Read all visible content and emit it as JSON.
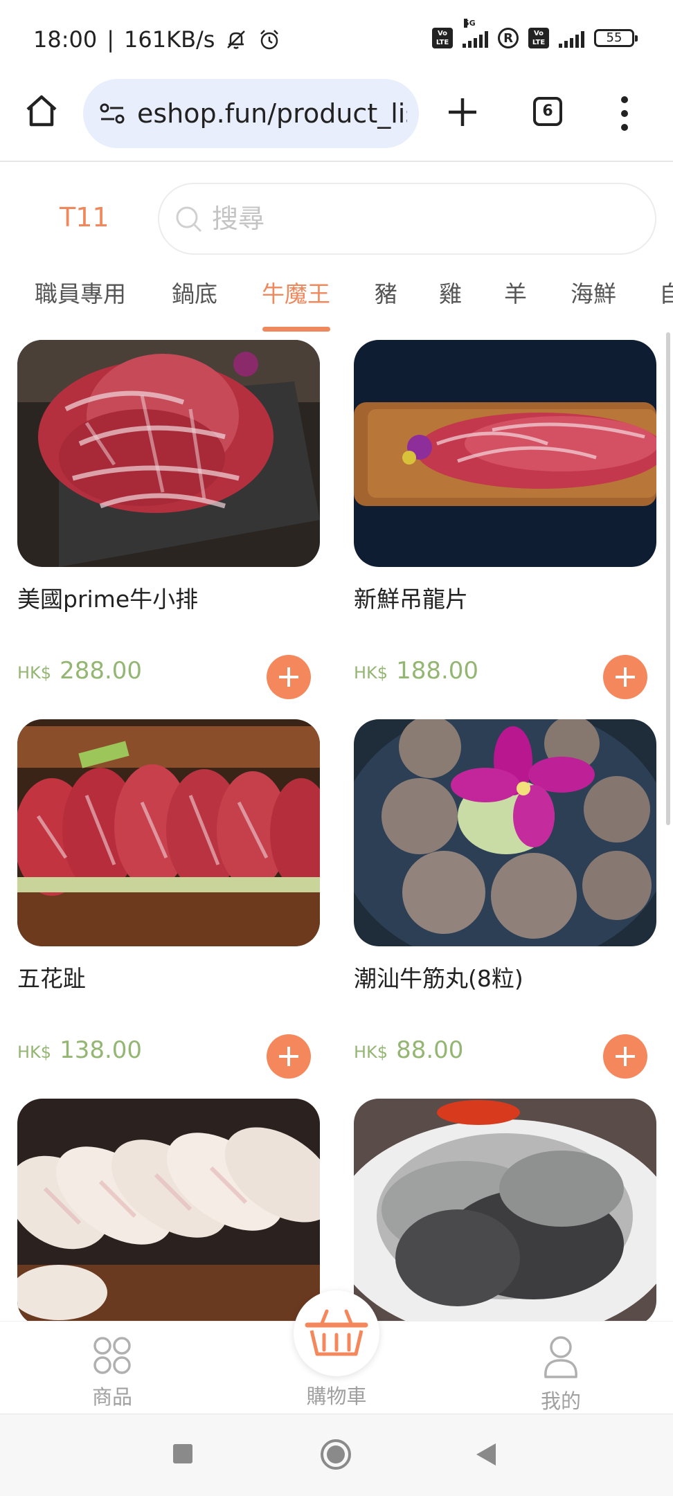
{
  "status_bar": {
    "time": "18:00",
    "net_speed": "161KB/s",
    "network_label": "5G",
    "battery": "55",
    "volte_label": "Vo LTE",
    "roaming_label": "R"
  },
  "browser": {
    "url": "eshop.fun/product_lis",
    "tab_count": "6"
  },
  "header": {
    "table_label": "T11",
    "search_placeholder": "搜尋"
  },
  "categories": {
    "active_index": 2,
    "items": [
      "職員專用",
      "鍋底",
      "牛魔王",
      "豬",
      "雞",
      "羊",
      "海鮮",
      "自"
    ]
  },
  "products": [
    {
      "name": "美國prime牛小排",
      "currency": "HK$",
      "price": "288.00"
    },
    {
      "name": "新鮮吊龍片",
      "currency": "HK$",
      "price": "188.00"
    },
    {
      "name": "五花趾",
      "currency": "HK$",
      "price": "138.00"
    },
    {
      "name": "潮汕牛筋丸(8粒)",
      "currency": "HK$",
      "price": "88.00"
    },
    {
      "name": "",
      "currency": "",
      "price": ""
    },
    {
      "name": "",
      "currency": "",
      "price": ""
    }
  ],
  "bottom_nav": {
    "products_label": "商品",
    "cart_label": "購物車",
    "mine_label": "我的"
  },
  "colors": {
    "accent": "#f4885c",
    "price_green": "#94b673"
  },
  "icons": {
    "home": "home-icon",
    "site_settings": "tune-icon",
    "new_tab": "plus-icon",
    "menu": "more-vert-icon",
    "search": "search-icon",
    "add": "add-icon",
    "products": "grid-icon",
    "cart": "basket-icon",
    "mine": "person-icon"
  }
}
